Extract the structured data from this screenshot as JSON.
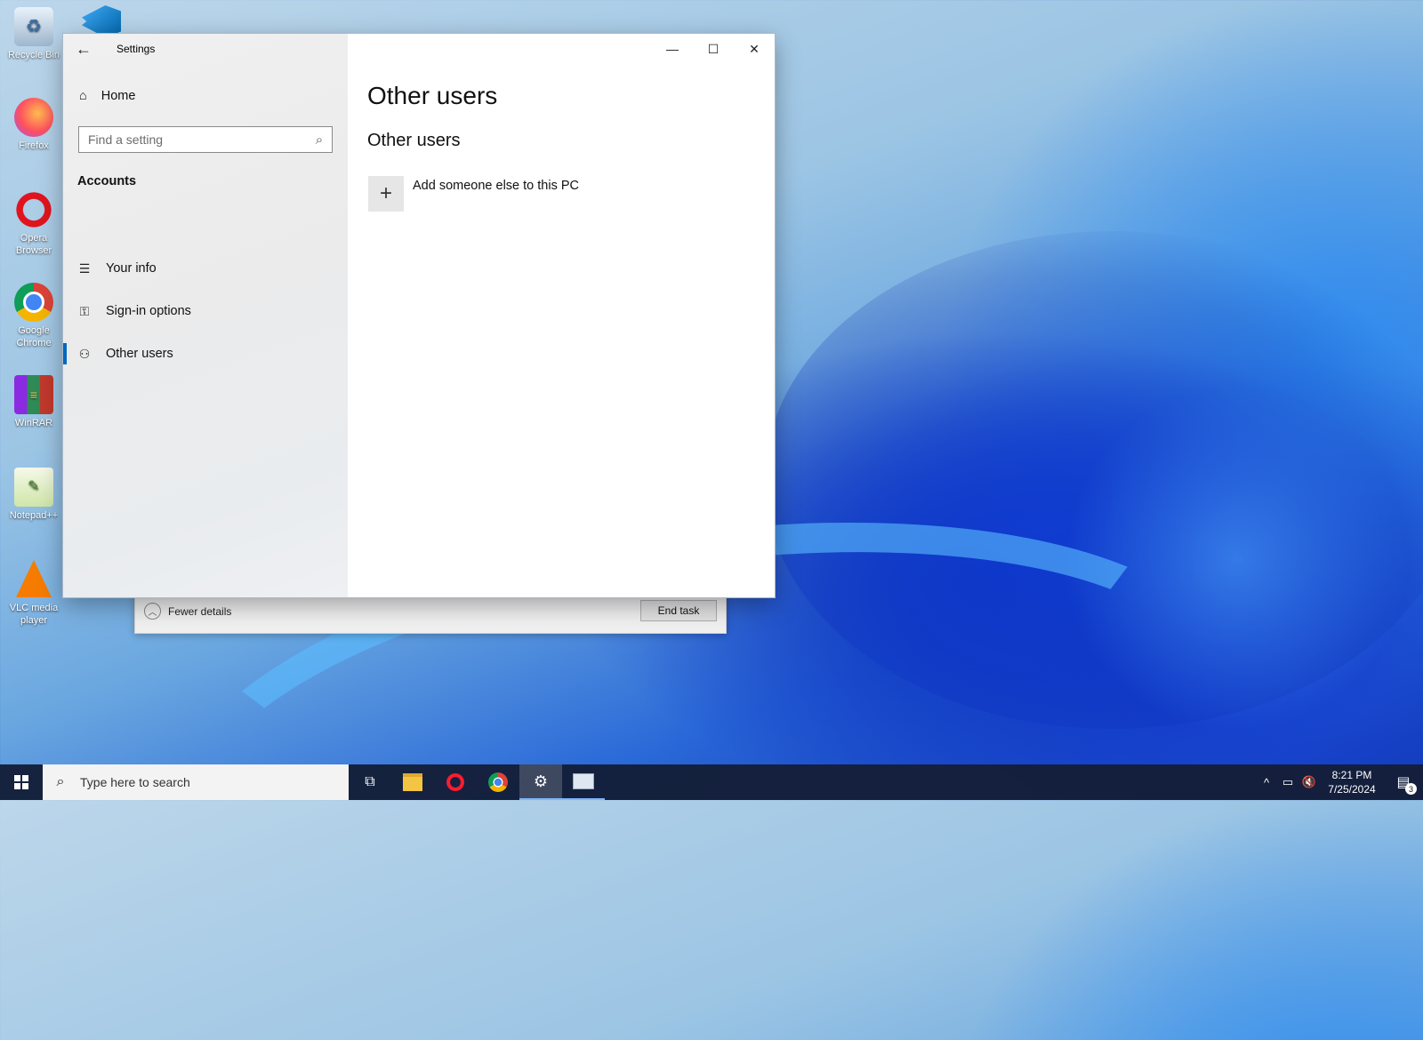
{
  "desktop": {
    "icons": [
      {
        "label": "Recycle Bin",
        "icon": "recycle-bin-icon"
      },
      {
        "label": "Firefox",
        "icon": "firefox-icon"
      },
      {
        "label": "Opera Browser",
        "icon": "opera-icon"
      },
      {
        "label": "Google Chrome",
        "icon": "chrome-icon"
      },
      {
        "label": "WinRAR",
        "icon": "winrar-icon"
      },
      {
        "label": "Notepad++",
        "icon": "notepadpp-icon"
      },
      {
        "label": "VLC media player",
        "icon": "vlc-icon"
      }
    ]
  },
  "taskmanager": {
    "fewer_details": "Fewer details",
    "end_task": "End task"
  },
  "settings": {
    "title": "Settings",
    "nav": {
      "home": "Home",
      "search_placeholder": "Find a setting",
      "section": "Accounts",
      "items": [
        {
          "label": "Your info",
          "icon": "person-card-icon"
        },
        {
          "label": "Sign-in options",
          "icon": "key-icon"
        },
        {
          "label": "Other users",
          "icon": "add-person-icon",
          "active": true
        }
      ]
    },
    "main": {
      "page_title": "Other users",
      "section_title": "Other users",
      "add_label": "Add someone else to this PC"
    }
  },
  "taskbar": {
    "search_placeholder": "Type here to search",
    "time": "8:21 PM",
    "date": "7/25/2024",
    "notification_count": "3"
  }
}
